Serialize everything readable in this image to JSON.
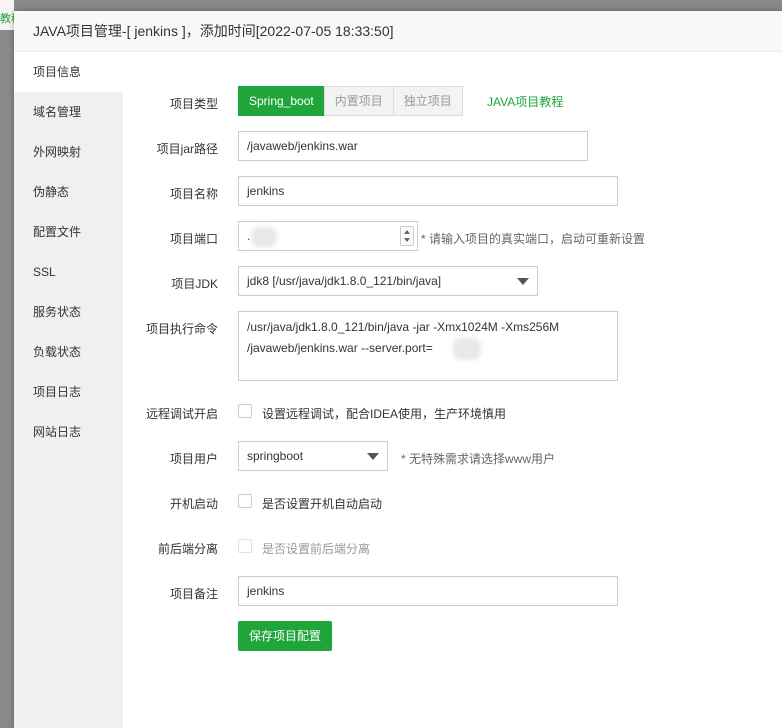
{
  "background": {
    "peek_text": "教程"
  },
  "dialog": {
    "title": "JAVA项目管理-[ jenkins ]，添加时间[2022-07-05 18:33:50]"
  },
  "sidebar": {
    "items": [
      {
        "label": "项目信息",
        "active": true
      },
      {
        "label": "域名管理"
      },
      {
        "label": "外网映射"
      },
      {
        "label": "伪静态"
      },
      {
        "label": "配置文件"
      },
      {
        "label": "SSL"
      },
      {
        "label": "服务状态"
      },
      {
        "label": "负载状态"
      },
      {
        "label": "项目日志"
      },
      {
        "label": "网站日志"
      }
    ]
  },
  "form": {
    "project_type": {
      "label": "项目类型",
      "options": [
        "Spring_boot",
        "内置项目",
        "独立项目"
      ],
      "selected": "Spring_boot",
      "tutorial_link": "JAVA项目教程"
    },
    "jar_path": {
      "label": "项目jar路径",
      "value": "/javaweb/jenkins.war"
    },
    "project_name": {
      "label": "项目名称",
      "value": "jenkins"
    },
    "project_port": {
      "label": "项目端口",
      "value": ".",
      "hint": "* 请输入项目的真实端口，启动可重新设置"
    },
    "project_jdk": {
      "label": "项目JDK",
      "value": "jdk8 [/usr/java/jdk1.8.0_121/bin/java]"
    },
    "exec_command": {
      "label": "项目执行命令",
      "line1": "/usr/java/jdk1.8.0_121/bin/java -jar -Xmx1024M -Xms256M",
      "line2": "/javaweb/jenkins.war --server.port="
    },
    "remote_debug": {
      "label": "远程调试开启",
      "text": "设置远程调试，配合IDEA使用，生产环境慎用"
    },
    "project_user": {
      "label": "项目用户",
      "value": "springboot",
      "hint": "* 无特殊需求请选择www用户"
    },
    "auto_start": {
      "label": "开机启动",
      "text": "是否设置开机自动启动"
    },
    "separation": {
      "label": "前后端分离",
      "text": "是否设置前后端分离"
    },
    "remark": {
      "label": "项目备注",
      "value": "jenkins"
    },
    "save_label": "保存项目配置"
  },
  "colors": {
    "accent": "#20a53a"
  }
}
